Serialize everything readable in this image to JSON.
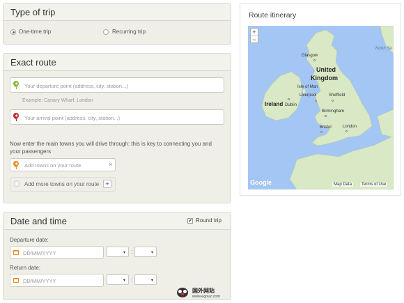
{
  "trip_type": {
    "title": "Type of trip",
    "options": [
      "One-time trip",
      "Recurring trip"
    ],
    "selected": "One-time trip"
  },
  "route": {
    "title": "Exact route",
    "departure_placeholder": "Your departure point (address, city, station...)",
    "departure_example": "Example: Canary Wharf, London",
    "arrival_placeholder": "Your arrival point (address, city, station...)",
    "instructions": "Now enter the main towns you will drive through: this is key to connecting you and your passengers",
    "towns_placeholder": "Add towns on your route",
    "add_more_label": "Add more towns on your route",
    "add_button": "+",
    "clear_button": "×"
  },
  "datetime": {
    "title": "Date and time",
    "round_trip_label": "Round trip",
    "round_trip_checked": true,
    "departure_label": "Departure date:",
    "return_label": "Return date:",
    "date_placeholder": "DD/MM/YYYY",
    "time_separator": ":",
    "caret": "▾"
  },
  "itinerary": {
    "title": "Route itinerary",
    "zoom_in": "+",
    "zoom_out": "−",
    "map_labels": {
      "north_sea": "North Se",
      "glasgow": "Glasgow",
      "uk_line1": "United",
      "uk_line2": "Kingdom",
      "isle_of_man": "Isle of Man",
      "ireland": "Ireland",
      "dublin": "Dublin",
      "liverpool": "Liverpool",
      "sheffield": "Sheffield",
      "birmingham": "Birmingham",
      "bristol": "Bristol",
      "london": "London"
    },
    "google": "Google",
    "map_data": "Map Data",
    "terms": "Terms of Use"
  },
  "watermark": {
    "text": "国外网站",
    "url": "www.egouz.com"
  },
  "colors": {
    "panel_bg": "#efefe8",
    "pin_green": "#8ab833",
    "pin_red": "#c0272d",
    "pin_orange": "#f08a24",
    "sea": "#a4c6f4",
    "land": "#d9e8c5"
  }
}
